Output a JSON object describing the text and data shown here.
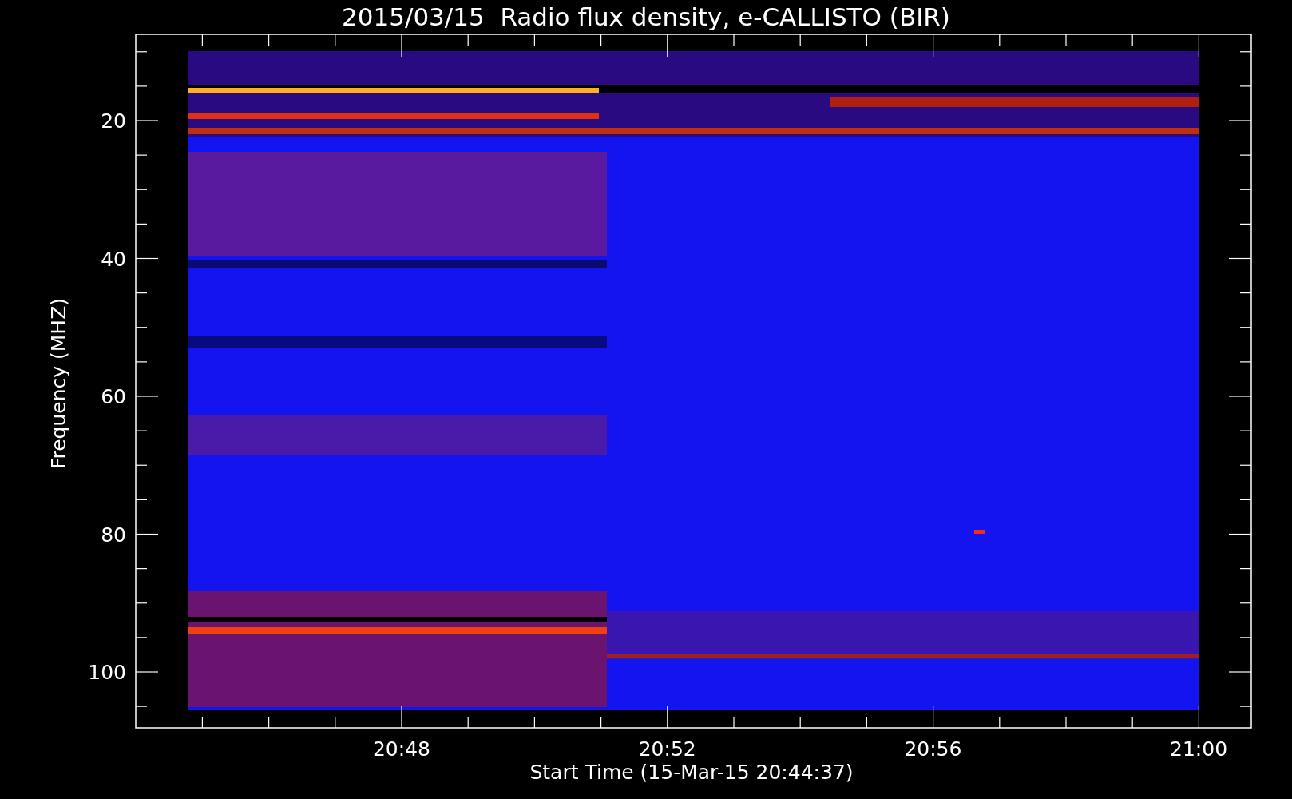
{
  "title": "2015/03/15  Radio flux density, e-CALLISTO (BIR)",
  "y_axis": {
    "label": "Frequency (MHZ)",
    "ticks": [
      "20",
      "40",
      "60",
      "80",
      "100"
    ]
  },
  "x_axis": {
    "label": "Start Time (15-Mar-15 20:44:37)",
    "ticks": [
      "20:48",
      "20:52",
      "20:56",
      "21:00"
    ]
  }
}
